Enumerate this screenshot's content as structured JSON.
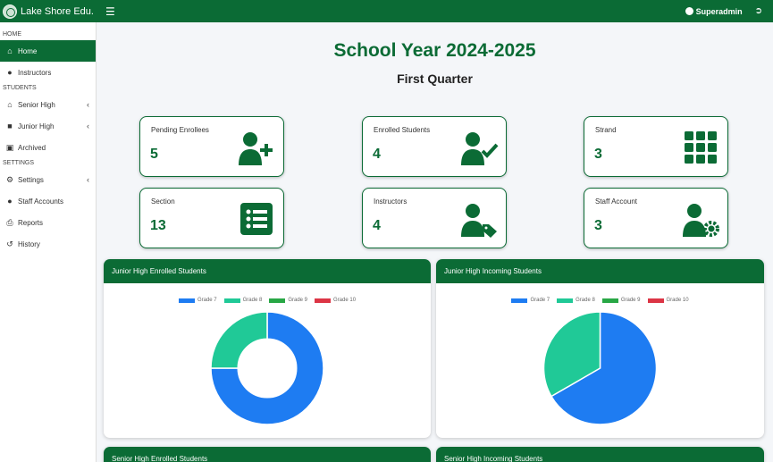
{
  "app": {
    "title": "Lake Shore Edu. Ins.",
    "menu_icon": "hamburger-icon"
  },
  "topbar": {
    "user": "Superadmin",
    "user_icon": "user-circle-icon",
    "logout_icon": "logout-icon"
  },
  "sidebar": {
    "sections": [
      "HOME",
      "STUDENTS",
      "SETTINGS"
    ],
    "items": [
      {
        "label": "Home",
        "icon": "home-icon"
      },
      {
        "label": "Instructors",
        "icon": "instructors-icon"
      },
      {
        "label": "Senior High",
        "icon": "institution-icon"
      },
      {
        "label": "Junior High",
        "icon": "school-icon"
      },
      {
        "label": "Archived",
        "icon": "archive-icon"
      },
      {
        "label": "Settings",
        "icon": "gear-icon"
      },
      {
        "label": "Staff Accounts",
        "icon": "staff-icon"
      },
      {
        "label": "Reports",
        "icon": "printer-icon"
      },
      {
        "label": "History",
        "icon": "history-icon"
      }
    ]
  },
  "main": {
    "title": "School Year 2024-2025",
    "subtitle": "First Quarter",
    "cards": [
      {
        "label": "Pending Enrollees",
        "value": "5",
        "icon": "user-plus-icon"
      },
      {
        "label": "Enrolled Students",
        "value": "4",
        "icon": "user-check-icon"
      },
      {
        "label": "Strand",
        "value": "3",
        "icon": "grid-icon"
      },
      {
        "label": "Section",
        "value": "13",
        "icon": "list-icon"
      },
      {
        "label": "Instructors",
        "value": "4",
        "icon": "user-tag-icon"
      },
      {
        "label": "Staff Account",
        "value": "3",
        "icon": "user-gear-icon"
      }
    ],
    "panels": [
      {
        "title": "Junior High Enrolled Students"
      },
      {
        "title": "Junior High Incoming Students"
      },
      {
        "title": "Senior High Enrolled Students"
      },
      {
        "title": "Senior High Incoming Students"
      }
    ]
  },
  "colors": {
    "brand": "#0b6b35",
    "grade7": "#1e7cf2",
    "grade8": "#20c997",
    "grade9": "#28a745",
    "grade10": "#dc3545"
  },
  "chart_data": [
    {
      "type": "pie",
      "variant": "doughnut",
      "categories": [
        "Grade 7",
        "Grade 8",
        "Grade 9",
        "Grade 10"
      ],
      "values": [
        3,
        1,
        0,
        0
      ],
      "legend": "top"
    },
    {
      "type": "pie",
      "categories": [
        "Grade 7",
        "Grade 8",
        "Grade 9",
        "Grade 10"
      ],
      "values": [
        2,
        1,
        0,
        0
      ],
      "legend": "top"
    }
  ]
}
